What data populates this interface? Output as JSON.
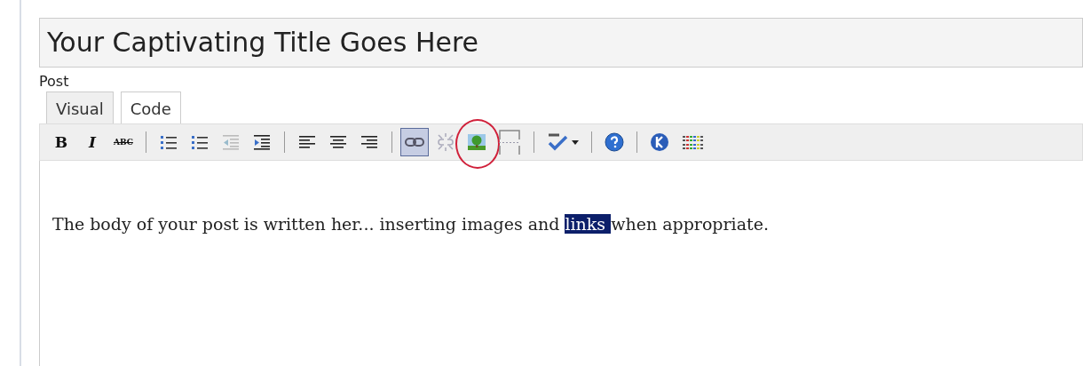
{
  "title_field": {
    "value": "Your Captivating Title Goes Here"
  },
  "post_label": "Post",
  "tabs": [
    {
      "label": "Visual",
      "selected": true
    },
    {
      "label": "Code",
      "selected": false
    }
  ],
  "toolbar": [
    {
      "kind": "bold",
      "label": "B",
      "active": false,
      "circled": false
    },
    {
      "kind": "italic",
      "label": "I",
      "active": false,
      "circled": false
    },
    {
      "kind": "strike",
      "label": "ABC",
      "active": false,
      "circled": false
    },
    {
      "kind": "separator"
    },
    {
      "kind": "bullets",
      "active": false,
      "circled": false
    },
    {
      "kind": "numbers",
      "active": false,
      "circled": false
    },
    {
      "kind": "outdent",
      "active": false,
      "circled": false
    },
    {
      "kind": "indent",
      "active": false,
      "circled": false
    },
    {
      "kind": "separator"
    },
    {
      "kind": "align-left",
      "active": false,
      "circled": false
    },
    {
      "kind": "align-center",
      "active": false,
      "circled": false
    },
    {
      "kind": "align-right",
      "active": false,
      "circled": false
    },
    {
      "kind": "separator"
    },
    {
      "kind": "link",
      "active": true,
      "circled": false
    },
    {
      "kind": "unlink",
      "active": false,
      "circled": false
    },
    {
      "kind": "image",
      "active": false,
      "circled": true
    },
    {
      "kind": "pagebreak",
      "active": false,
      "circled": false
    },
    {
      "kind": "separator"
    },
    {
      "kind": "spellcheck",
      "active": false,
      "circled": false
    },
    {
      "kind": "separator"
    },
    {
      "kind": "help",
      "active": false,
      "circled": false
    },
    {
      "kind": "separator"
    },
    {
      "kind": "kitchen",
      "active": false,
      "circled": false
    },
    {
      "kind": "colors",
      "active": false,
      "circled": false
    }
  ],
  "body": {
    "text_before": "The body of your post is written her... inserting images and ",
    "selected": "links ",
    "text_after": "when appropriate."
  }
}
